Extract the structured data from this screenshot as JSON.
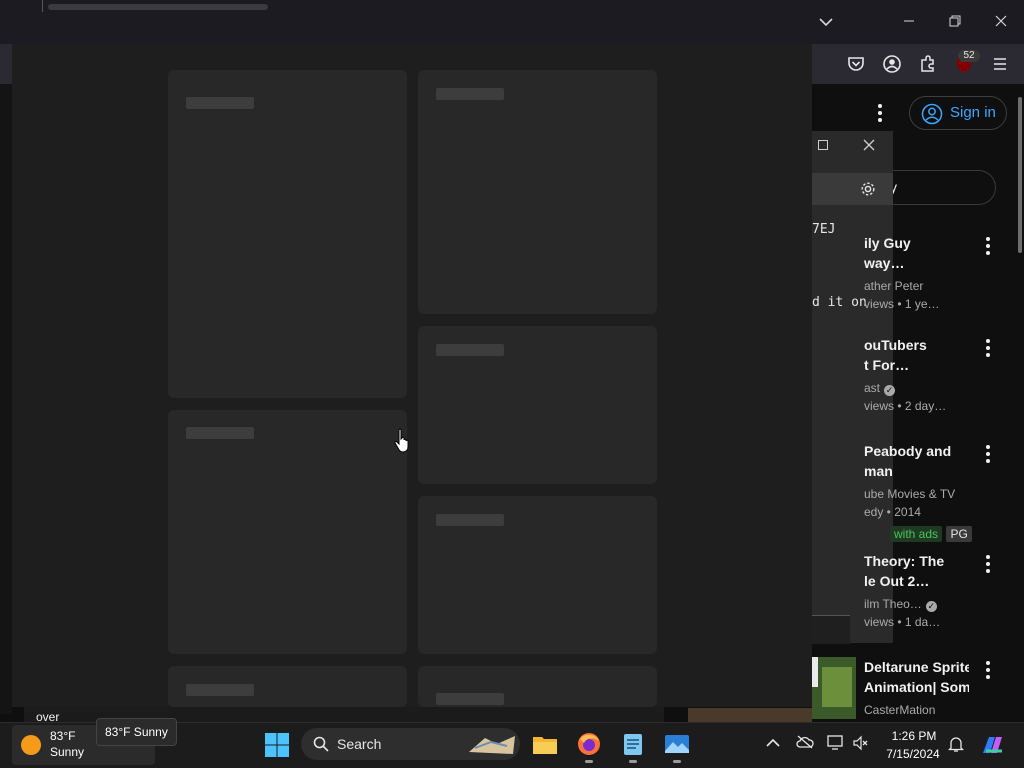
{
  "browser": {
    "window_controls": {
      "list_tabs": "⌄",
      "minimize": "—",
      "restore": "❐",
      "close": "✕"
    },
    "toolbar": {
      "notification_count": "52"
    },
    "youtube": {
      "sign_in_label": "Sign in",
      "search_partial": "y",
      "dialog_code_lines": [
        "7EJ",
        "d it on"
      ],
      "videos": [
        {
          "title1": "ily Guy",
          "title2": "way…",
          "meta1": "ather Peter",
          "meta2": "views  • 1 ye…"
        },
        {
          "title1": "ouTubers",
          "title2": "t For…",
          "meta1": "ast",
          "meta2": "views  • 2 day…",
          "verified": true
        },
        {
          "title1": "Peabody and",
          "title2": "man",
          "meta1": "ube Movies & TV",
          "meta2": "edy • 2014",
          "chip_free": "with ads",
          "chip_pg": "PG"
        },
        {
          "title1": " Theory: The",
          "title2": "le Out 2…",
          "meta1": "ilm Theo…",
          "meta2": "views  • 1 da…",
          "verified": true
        },
        {
          "title1": "Deltarune Sprite",
          "title2": "Animation| Som…",
          "meta1": "CasterMation"
        }
      ]
    }
  },
  "foreground": {
    "partial_text": "over"
  },
  "taskbar": {
    "weather": {
      "temp": "83°F",
      "condition": "Sunny",
      "tooltip": "83°F Sunny"
    },
    "search_label": "Search",
    "clock": {
      "time": "1:26 PM",
      "date": "7/15/2024"
    }
  },
  "colors": {
    "accent_link": "#3ea6ff",
    "free_chip": "#4cc35b",
    "weather_sun": "#f59b19"
  }
}
